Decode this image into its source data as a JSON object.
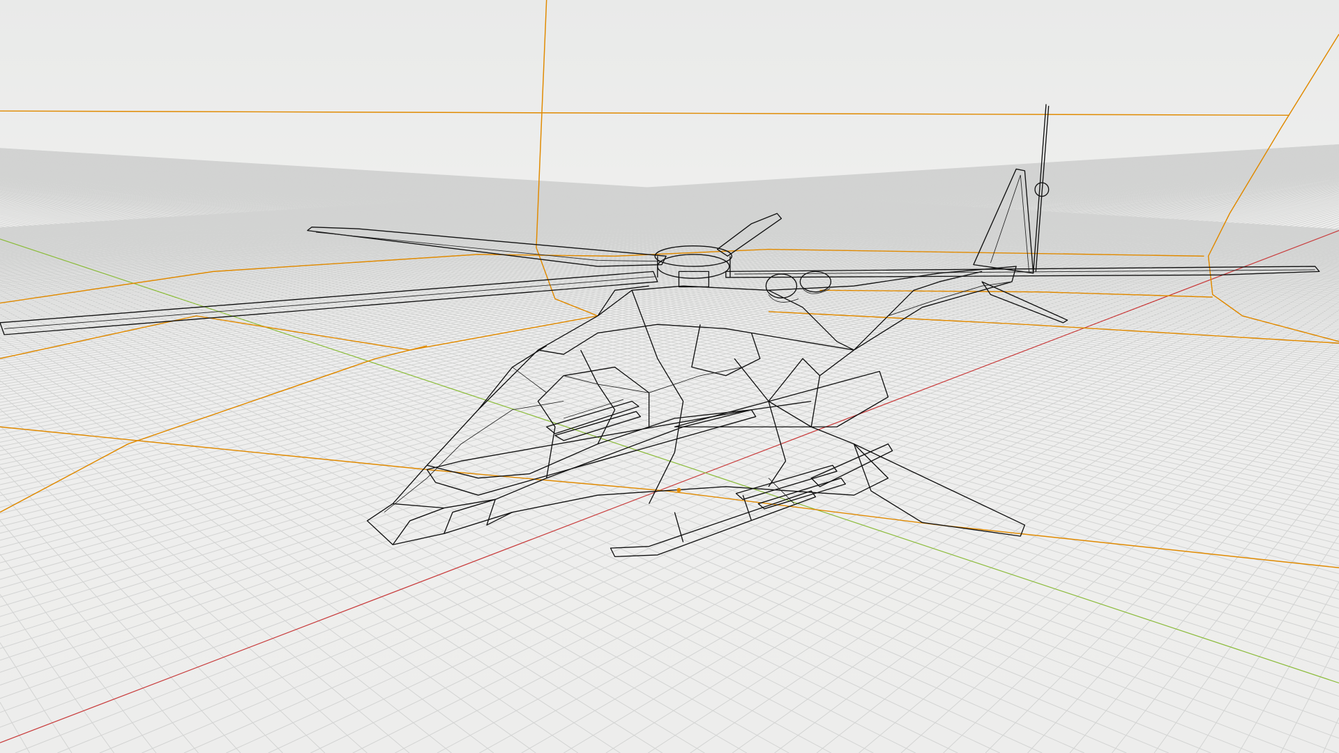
{
  "viewport": {
    "colors": {
      "background": "#ececeb",
      "grid": "#d2d3d2",
      "x_axis": "#c83c3c",
      "y_axis": "#8cbc3c",
      "wire": "#111111",
      "selection": "#e08a00"
    },
    "icons": [
      "helicopter-wireframe",
      "origin-point"
    ]
  }
}
